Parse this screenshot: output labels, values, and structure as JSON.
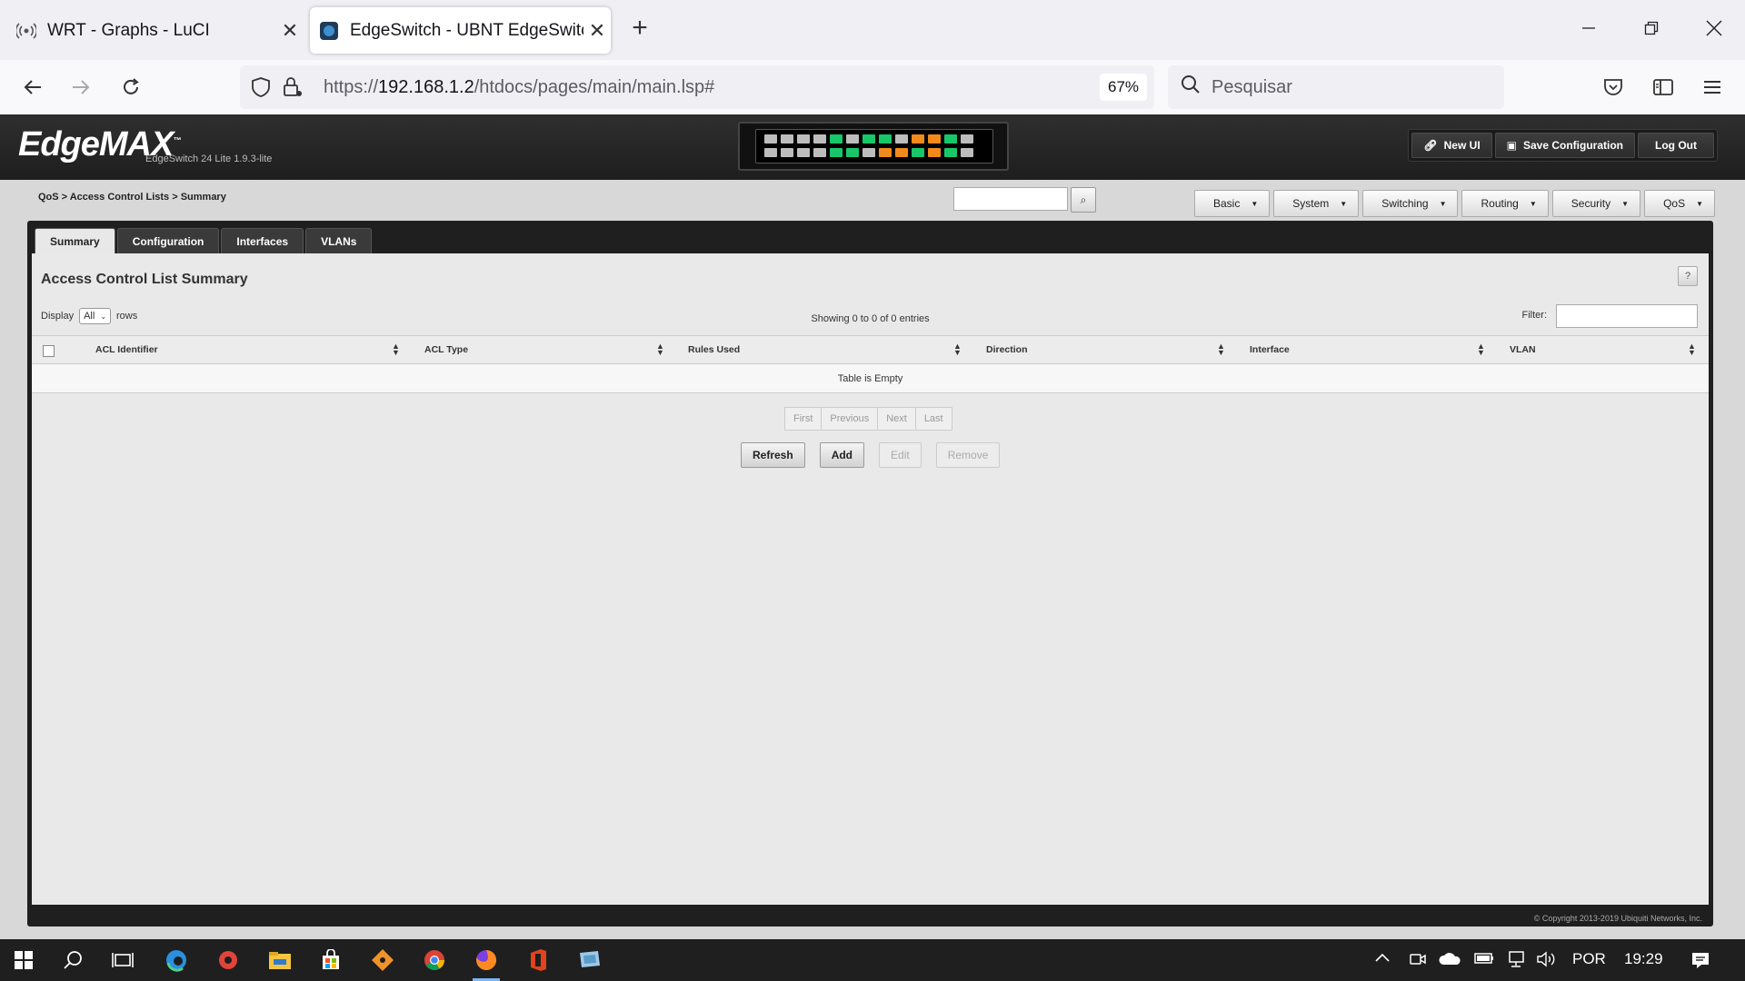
{
  "browser": {
    "tabs": [
      {
        "label": "WRT - Graphs - LuCI",
        "icon": "wireless-icon"
      },
      {
        "label": "EdgeSwitch - UBNT EdgeSwitch",
        "icon": "edgeswitch-favicon"
      }
    ],
    "url_prefix": "https://",
    "url_host": "192.168.1.2",
    "url_path": "/htdocs/pages/main/main.lsp#",
    "zoom": "67%",
    "search_placeholder": "Pesquisar"
  },
  "header": {
    "logo": "EdgeMAX",
    "logo_tm": "™",
    "model": "EdgeSwitch 24 Lite 1.9.3-lite",
    "buttons": [
      "New UI",
      "Save Configuration",
      "Log Out"
    ]
  },
  "ports": {
    "top": [
      "gray",
      "gray",
      "gray",
      "gray",
      "green",
      "gray",
      "green",
      "green",
      "gray",
      "orange",
      "orange",
      "green",
      "gray"
    ],
    "bottom": [
      "gray",
      "gray",
      "gray",
      "gray",
      "green",
      "green",
      "gray",
      "orange",
      "orange",
      "green",
      "orange",
      "green",
      "gray"
    ]
  },
  "breadcrumb": "QoS > Access Control Lists > Summary",
  "menu": [
    "Basic",
    "System",
    "Switching",
    "Routing",
    "Security",
    "QoS"
  ],
  "page_tabs": [
    "Summary",
    "Configuration",
    "Interfaces",
    "VLANs"
  ],
  "section_title": "Access Control List Summary",
  "help_label": "?",
  "display": {
    "label": "Display",
    "value": "All",
    "suffix": "rows"
  },
  "showing": "Showing 0 to 0 of 0 entries",
  "filter_label": "Filter:",
  "table": {
    "columns": [
      "ACL Identifier",
      "ACL Type",
      "Rules Used",
      "Direction",
      "Interface",
      "VLAN"
    ],
    "empty_text": "Table is Empty"
  },
  "pager": [
    "First",
    "Previous",
    "Next",
    "Last"
  ],
  "actions": [
    "Refresh",
    "Add",
    "Edit",
    "Remove"
  ],
  "copyright": "© Copyright 2013-2019 Ubiquiti Networks, Inc.",
  "taskbar": {
    "language": "POR",
    "time": "19:29"
  },
  "colors": {
    "port_green": "#17c76a",
    "port_orange": "#f28a1b",
    "port_gray": "#bdbdbd",
    "header_bg": "#262626"
  }
}
